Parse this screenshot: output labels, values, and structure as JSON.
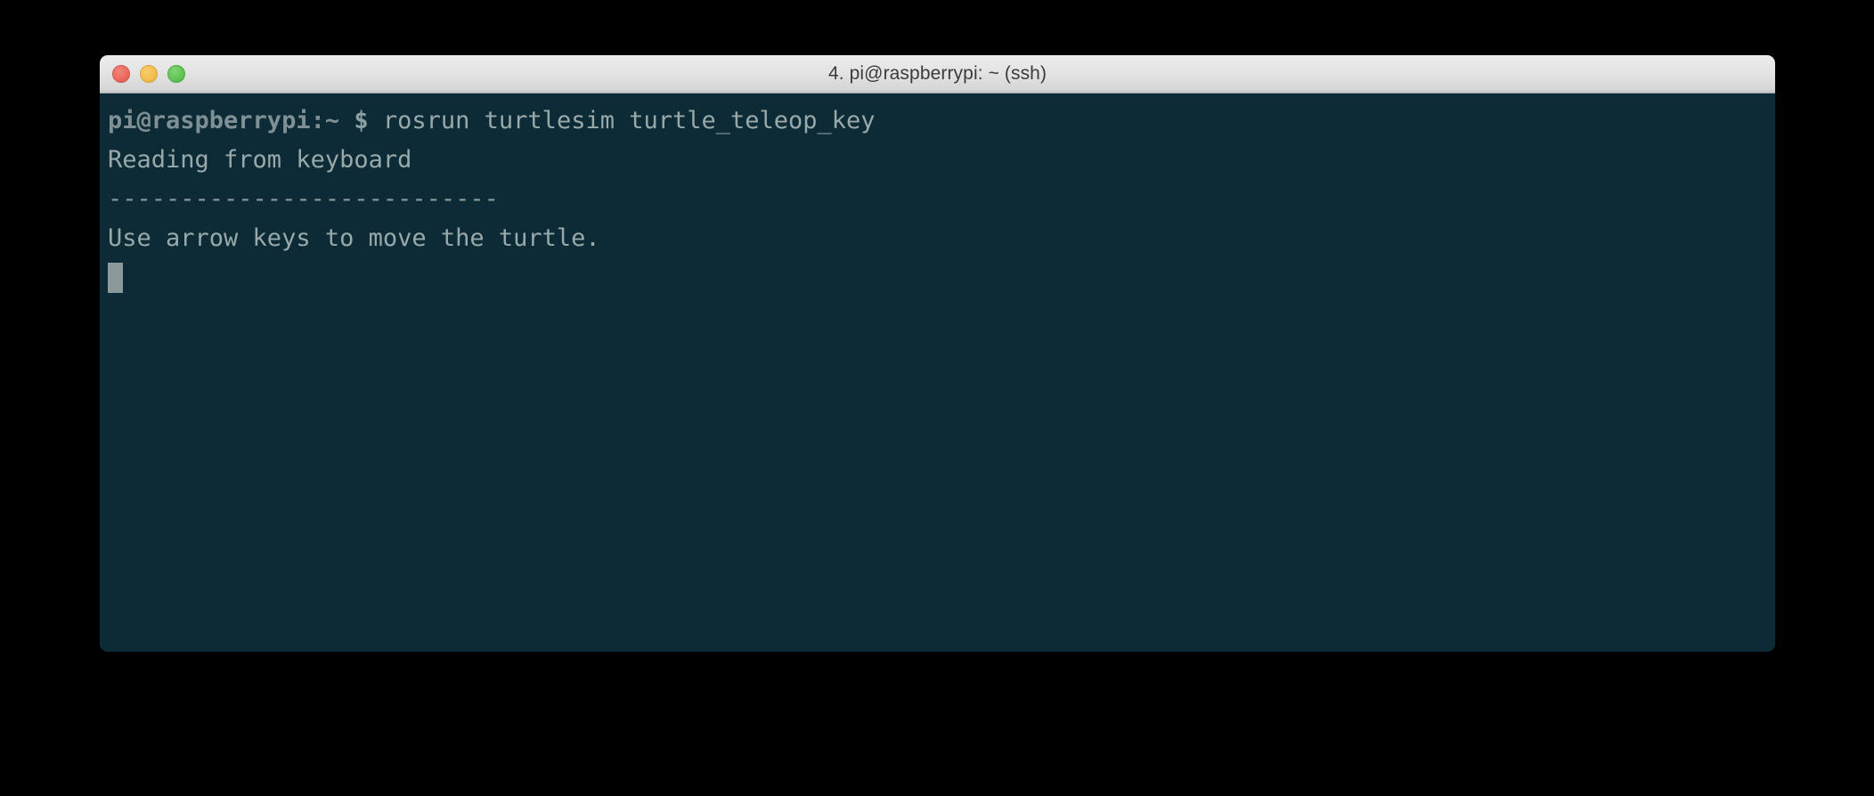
{
  "window": {
    "title": "4. pi@raspberrypi: ~ (ssh)",
    "controls": {
      "close_label": "close",
      "minimize_label": "minimize",
      "zoom_label": "zoom"
    },
    "colors": {
      "titlebar_top": "#ececec",
      "titlebar_bottom": "#c6c6c6",
      "titlebar_text": "#3b3b3b",
      "close": "#ec6a5e",
      "minimize": "#f4bd4f",
      "zoom": "#61c554",
      "terminal_background": "#0c2b36",
      "terminal_text": "#99a9a9",
      "prompt_text": "#7e9094",
      "cursor": "#8a9a9a",
      "desktop": "#000000"
    }
  },
  "terminal": {
    "prompt": {
      "user_host_path": "pi@raspberrypi:~",
      "symbol": "$"
    },
    "command": "rosrun turtlesim turtle_teleop_key",
    "output_lines": [
      "Reading from keyboard",
      "---------------------------",
      "Use arrow keys to move the turtle."
    ],
    "cursor": {
      "shape": "block",
      "visible": true
    }
  }
}
